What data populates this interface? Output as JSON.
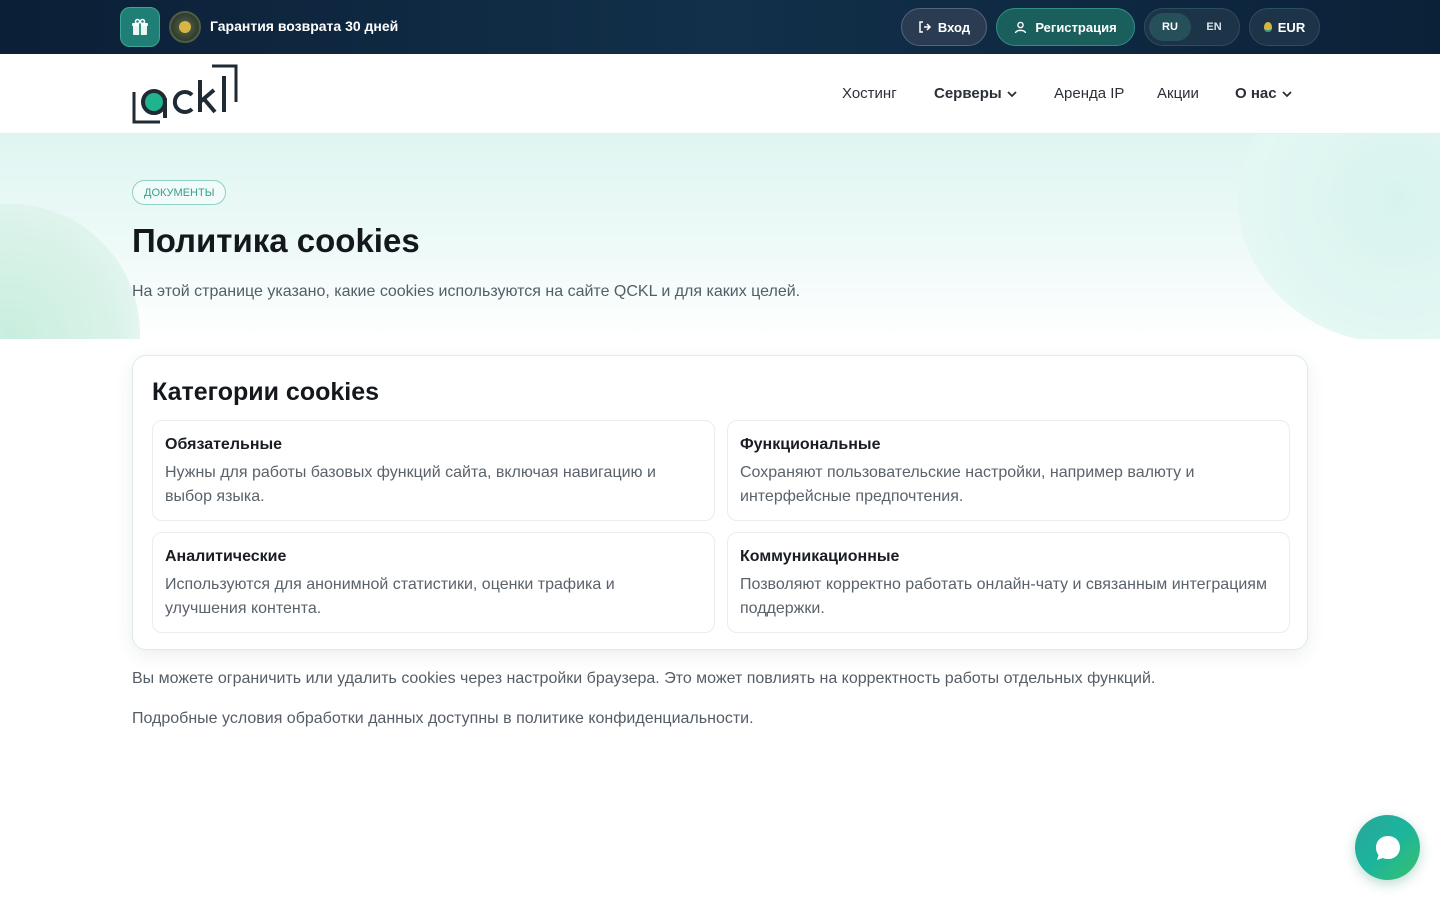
{
  "topbar": {
    "guarantee_text": "Гарантия возврата 30 дней",
    "login_label": "Вход",
    "register_label": "Регистрация",
    "languages": [
      "RU",
      "EN"
    ],
    "active_language": "RU",
    "currency": "EUR"
  },
  "nav": {
    "items": [
      {
        "label": "Хостинг",
        "dropdown": false
      },
      {
        "label": "Серверы",
        "dropdown": true
      },
      {
        "label": "Аренда IP",
        "dropdown": false
      },
      {
        "label": "Акции",
        "dropdown": false
      },
      {
        "label": "О нас",
        "dropdown": true
      }
    ]
  },
  "hero": {
    "badge": "ДОКУМЕНТЫ",
    "title": "Политика cookies",
    "subtitle": "На этой странице указано, какие cookies используются на сайте QCKL и для каких целей."
  },
  "categories": {
    "title": "Категории cookies",
    "items": [
      {
        "name": "Обязательные",
        "description": "Нужны для работы базовых функций сайта, включая навигацию и выбор языка."
      },
      {
        "name": "Функциональные",
        "description": "Сохраняют пользовательские настройки, например валюту и интерфейсные предпочтения."
      },
      {
        "name": "Аналитические",
        "description": "Используются для анонимной статистики, оценки трафика и улучшения контента."
      },
      {
        "name": "Коммуникационные",
        "description": "Позволяют корректно работать онлайн-чату и связанным интеграциям поддержки."
      }
    ]
  },
  "footer_paragraphs": [
    "Вы можете ограничить или удалить cookies через настройки браузера. Это может повлиять на корректность работы отдельных функций.",
    "Подробные условия обработки данных доступны в политике конфиденциальности."
  ],
  "colors": {
    "topbar_bg": "#0b1f36",
    "accent": "#2aa59a",
    "badge_text": "#3a9e8c"
  }
}
